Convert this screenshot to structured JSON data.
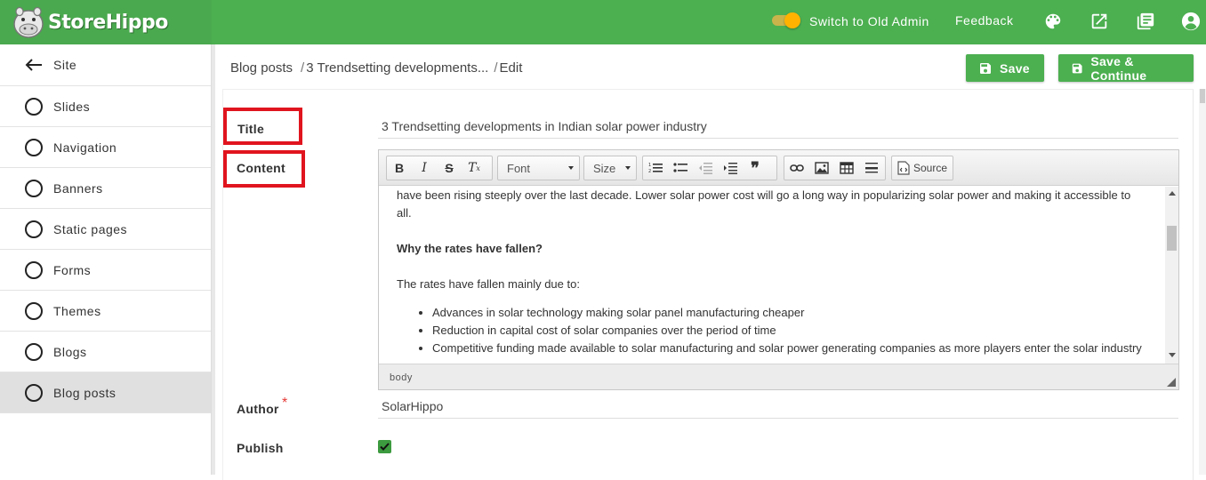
{
  "brand": {
    "name": "StoreHippo"
  },
  "topbar": {
    "switch_label": "Switch to Old Admin",
    "switch_on": true,
    "feedback_label": "Feedback",
    "icons": [
      "palette-icon",
      "open-external-icon",
      "catalog-icon",
      "account-icon"
    ]
  },
  "sidebar": {
    "back_label": "Site",
    "items": [
      {
        "label": "Slides",
        "active": false
      },
      {
        "label": "Navigation",
        "active": false
      },
      {
        "label": "Banners",
        "active": false
      },
      {
        "label": "Static pages",
        "active": false
      },
      {
        "label": "Forms",
        "active": false
      },
      {
        "label": "Themes",
        "active": false
      },
      {
        "label": "Blogs",
        "active": false
      },
      {
        "label": "Blog posts",
        "active": true
      }
    ]
  },
  "breadcrumb": {
    "items": [
      "Blog posts",
      "3 Trendsetting developments...",
      "Edit"
    ],
    "separator": "/"
  },
  "actions": {
    "save": "Save",
    "save_continue": "Save & Continue"
  },
  "form": {
    "title_label": "Title",
    "title_value": "3 Trendsetting developments in Indian solar power industry",
    "content_label": "Content",
    "author_label": "Author",
    "author_required": "*",
    "author_value": "SolarHippo",
    "publish_label": "Publish",
    "publish_checked": true
  },
  "editor": {
    "font_combo": "Font",
    "size_combo": "Size",
    "source_label": "Source",
    "status_path": "body",
    "paragraph1": "have been rising steeply over the last decade. Lower solar power cost will go a long way in popularizing solar power and making it accessible to all.",
    "heading": "Why the rates have fallen?",
    "paragraph2": "The rates have fallen mainly due to:",
    "bullets": [
      "Advances in solar technology making solar panel manufacturing cheaper",
      "Reduction in capital cost of solar companies over the period of time",
      "Competitive funding made available to solar manufacturing and solar power generating companies as more players enter the solar industry"
    ]
  },
  "colors": {
    "brand_green": "#4caf50",
    "highlight_red": "#e0141e",
    "toggle_orange": "#ffb300"
  }
}
